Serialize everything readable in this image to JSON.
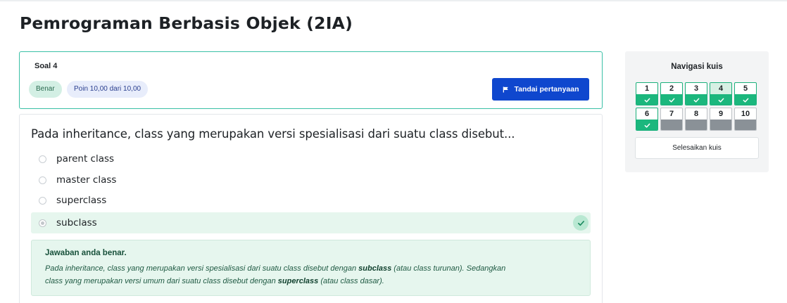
{
  "page": {
    "title": "Pemrograman Berbasis Objek (2IA)"
  },
  "question_info": {
    "label": "Soal 4",
    "status_badge": "Benar",
    "points_badge": "Poin 10,00 dari 10,00",
    "flag_button_label": "Tandai pertanyaan",
    "flag_icon": "flag-icon"
  },
  "question": {
    "text": "Pada inheritance, class yang merupakan versi spesialisasi dari suatu class disebut...",
    "options": [
      {
        "label": "parent class",
        "selected": false
      },
      {
        "label": "master class",
        "selected": false
      },
      {
        "label": "superclass",
        "selected": false
      },
      {
        "label": "subclass",
        "selected": true,
        "correct": true
      }
    ]
  },
  "feedback": {
    "title": "Jawaban anda benar.",
    "line1_a": "Pada inheritance, class yang merupakan versi spesialisasi dari suatu class disebut dengan ",
    "line1_b": "subclass",
    "line1_c": " (atau class turunan). Sedangkan",
    "line2_a": "class yang merupakan versi umum dari suatu class disebut dengan ",
    "line2_b": "superclass",
    "line2_c": " (atau class dasar)."
  },
  "navigation": {
    "title": "Navigasi kuis",
    "questions": [
      {
        "number": "1",
        "answered": true
      },
      {
        "number": "2",
        "answered": true
      },
      {
        "number": "3",
        "answered": true
      },
      {
        "number": "4",
        "answered": true,
        "current": true
      },
      {
        "number": "5",
        "answered": true
      },
      {
        "number": "6",
        "answered": true
      },
      {
        "number": "7",
        "answered": false
      },
      {
        "number": "8",
        "answered": false
      },
      {
        "number": "9",
        "answered": false
      },
      {
        "number": "10",
        "answered": false
      }
    ],
    "finish_label": "Selesaikan kuis"
  },
  "colors": {
    "primary": "#0f47ce",
    "correct_green": "#1bb77d",
    "correct_bg": "#e6f6ee",
    "card_border": "#3ac0a6"
  }
}
